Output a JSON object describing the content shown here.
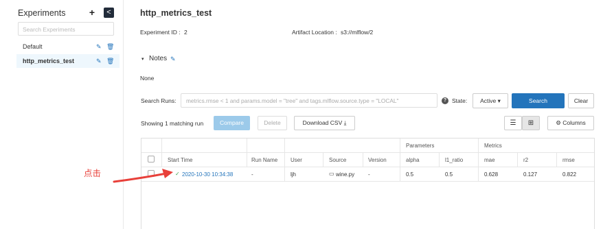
{
  "sidebar": {
    "title": "Experiments",
    "add_icon": "+",
    "collapse_icon": "<",
    "search_placeholder": "Search Experiments",
    "items": [
      {
        "label": "Default",
        "edit_icon": "✎",
        "delete_icon": "🗑"
      },
      {
        "label": "http_metrics_test",
        "edit_icon": "✎",
        "delete_icon": "🗑",
        "active": true
      }
    ]
  },
  "main": {
    "title": "http_metrics_test",
    "experiment_id_label": "Experiment ID :",
    "experiment_id": "2",
    "artifact_location_label": "Artifact Location :",
    "artifact_location": "s3://mlflow/2",
    "notes_caret": "▾",
    "notes_label": "Notes",
    "notes_edit_icon": "✎",
    "notes_value": "None"
  },
  "search": {
    "label": "Search Runs:",
    "placeholder": "metrics.rmse < 1 and params.model = \"tree\" and tags.mlflow.source.type = \"LOCAL\"",
    "help_icon": "?",
    "state_label": "State:",
    "state_value": "Active ▾",
    "search_button": "Search",
    "clear_button": "Clear"
  },
  "toolbar": {
    "match_text": "Showing 1 matching run",
    "compare": "Compare",
    "delete": "Delete",
    "download_csv": "Download CSV ⤓",
    "list_view_icon": "☰",
    "table_view_icon": "⊞",
    "columns": "⚙ Columns"
  },
  "table": {
    "groups": {
      "parameters": "Parameters",
      "metrics": "Metrics"
    },
    "headers": [
      "Start Time",
      "Run Name",
      "User",
      "Source",
      "Version",
      "alpha",
      "l1_ratio",
      "mae",
      "r2",
      "rmse"
    ],
    "rows": [
      {
        "status_icon": "✓",
        "start_time": "2020-10-30 10:34:38",
        "run_name": "-",
        "user": "ljh",
        "source_icon": "▭",
        "source": "wine.py",
        "version": "-",
        "alpha": "0.5",
        "l1_ratio": "0.5",
        "mae": "0.628",
        "r2": "0.127",
        "rmse": "0.822"
      }
    ]
  },
  "annotation": {
    "text": "点击",
    "color": "#e8403a"
  },
  "colors": {
    "primary": "#2374bb",
    "compare_disabled": "#9ccaea",
    "active_item_bg": "#eef7fd",
    "success": "#3ca654"
  }
}
